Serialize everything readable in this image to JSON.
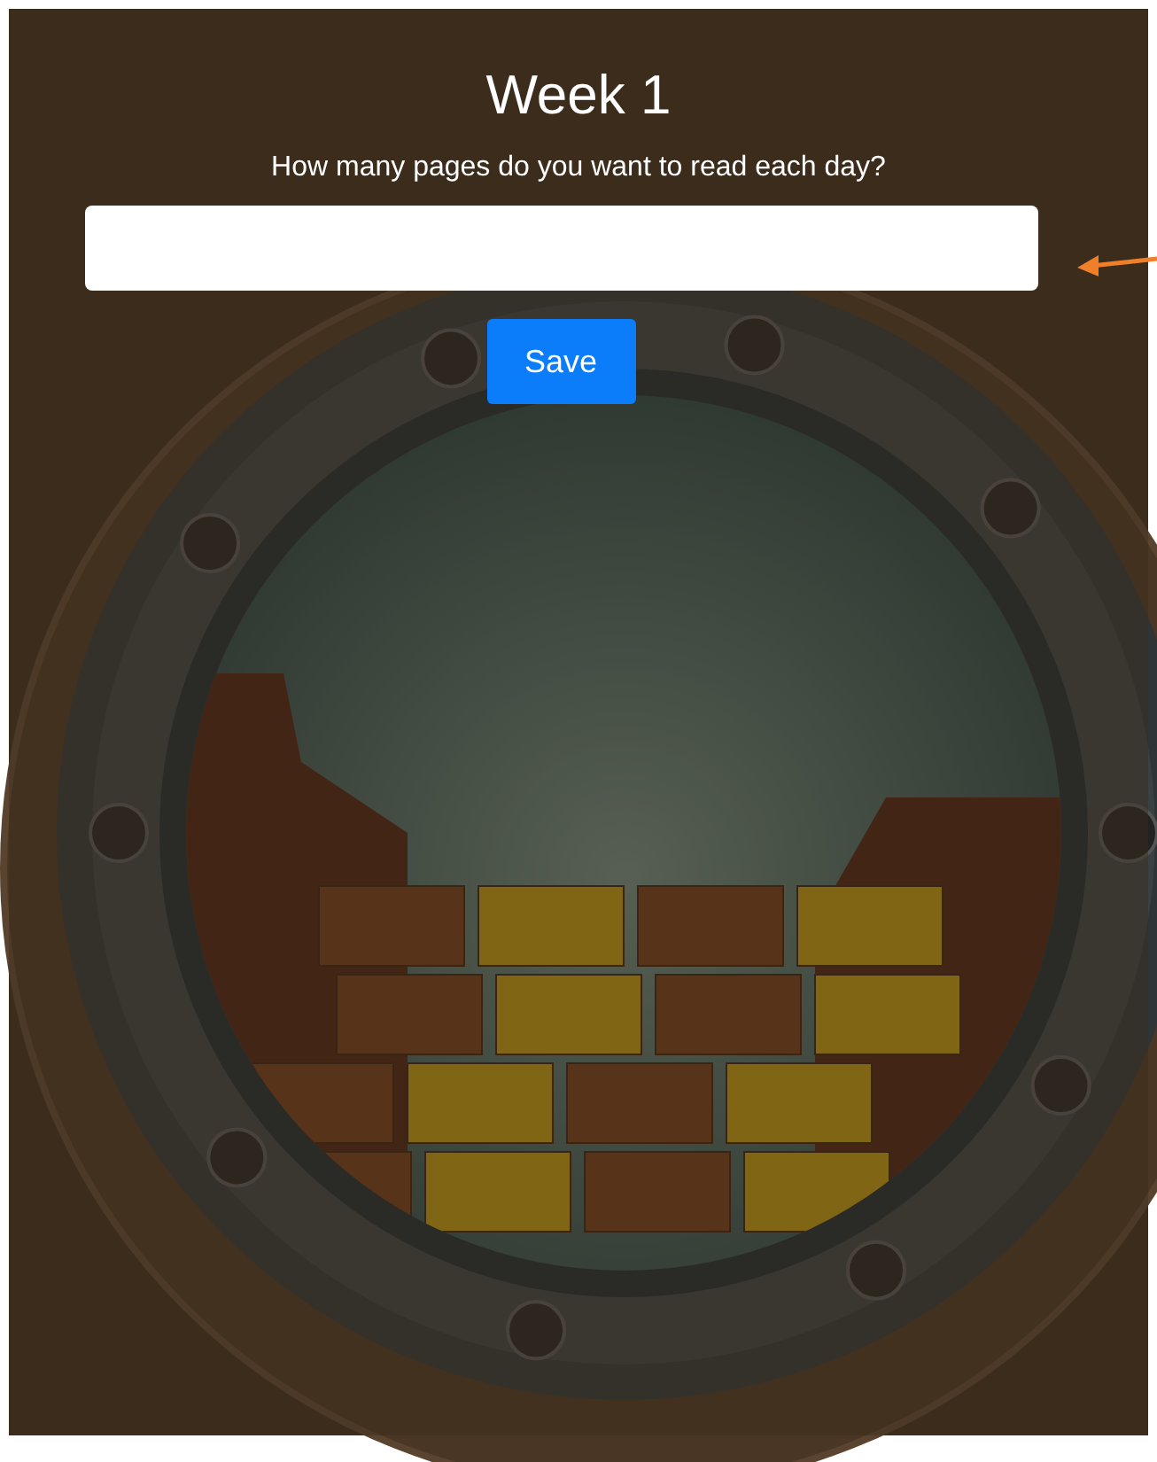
{
  "title": "Week 1",
  "question": "How many pages do you want to read each day?",
  "save_button": {
    "label": "Save"
  }
}
